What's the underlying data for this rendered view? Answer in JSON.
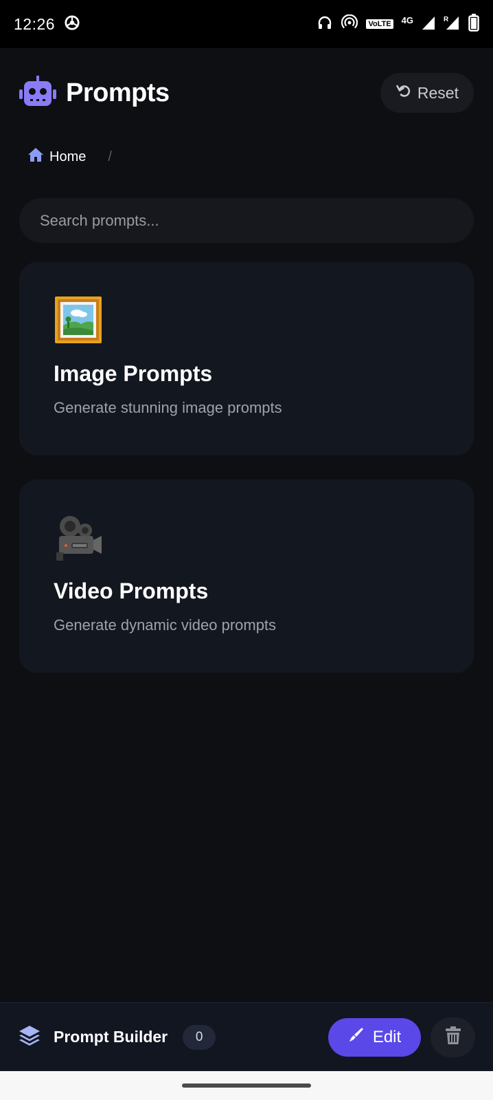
{
  "status_bar": {
    "time": "12:26",
    "volte": "VoLTE",
    "network": "4G",
    "roaming": "R"
  },
  "header": {
    "title": "Prompts",
    "reset_label": "Reset",
    "logo_icon": "robot-icon",
    "accent_color": "#8a7cf5"
  },
  "breadcrumb": {
    "home_label": "Home",
    "separator": "/"
  },
  "search": {
    "placeholder": "Search prompts...",
    "value": ""
  },
  "cards": [
    {
      "icon": "framed-picture-icon",
      "title": "Image Prompts",
      "description": "Generate stunning image prompts"
    },
    {
      "icon": "movie-camera-icon",
      "title": "Video Prompts",
      "description": "Generate dynamic video prompts"
    }
  ],
  "bottom_bar": {
    "label": "Prompt Builder",
    "count": "0",
    "edit_label": "Edit",
    "edit_color": "#5a48e8"
  }
}
